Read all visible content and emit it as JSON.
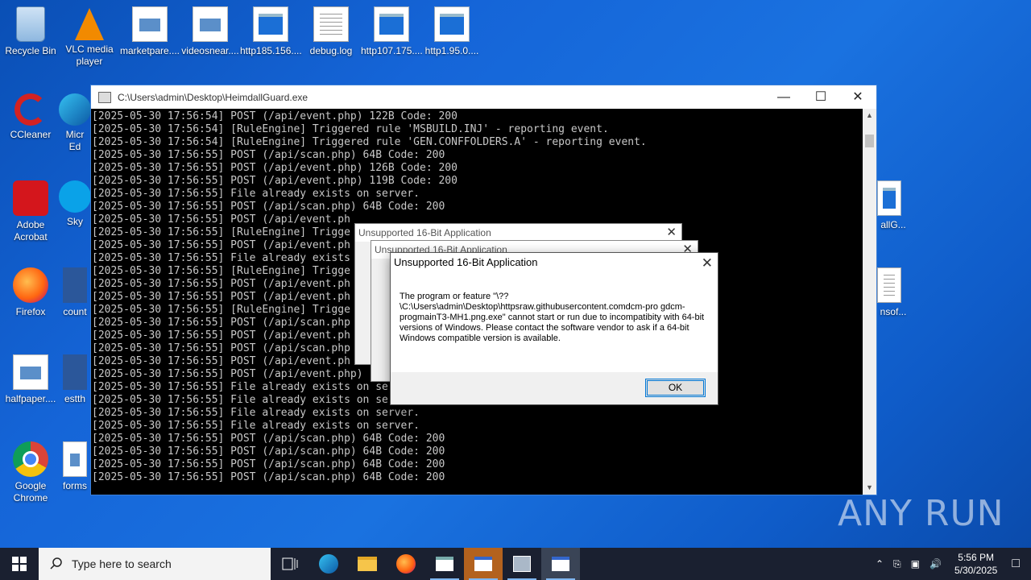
{
  "desktop": {
    "icons": [
      {
        "label": "Recycle Bin"
      },
      {
        "label": "VLC media player"
      },
      {
        "label": "marketpare...."
      },
      {
        "label": "videosnear...."
      },
      {
        "label": "http185.156...."
      },
      {
        "label": "debug.log"
      },
      {
        "label": "http107.175...."
      },
      {
        "label": "http1.95.0...."
      },
      {
        "label": "CCleaner"
      },
      {
        "label": "Micr Ed"
      },
      {
        "label": "Adobe Acrobat"
      },
      {
        "label": "Sky"
      },
      {
        "label": "Firefox"
      },
      {
        "label": "count"
      },
      {
        "label": "halfpaper...."
      },
      {
        "label": "estth"
      },
      {
        "label": "Google Chrome"
      },
      {
        "label": "forms"
      },
      {
        "label": "allG..."
      },
      {
        "label": "nsof..."
      }
    ]
  },
  "console": {
    "title": "C:\\Users\\admin\\Desktop\\HeimdallGuard.exe",
    "lines": [
      "[2025-05-30 17:56:54] POST (/api/event.php) 122B Code: 200",
      "[2025-05-30 17:56:54] [RuleEngine] Triggered rule 'MSBUILD.INJ' - reporting event.",
      "[2025-05-30 17:56:54] [RuleEngine] Triggered rule 'GEN.CONFFOLDERS.A' - reporting event.",
      "[2025-05-30 17:56:55] POST (/api/scan.php) 64B Code: 200",
      "[2025-05-30 17:56:55] POST (/api/event.php) 126B Code: 200",
      "[2025-05-30 17:56:55] POST (/api/event.php) 119B Code: 200",
      "[2025-05-30 17:56:55] File already exists on server.",
      "[2025-05-30 17:56:55] POST (/api/scan.php) 64B Code: 200",
      "[2025-05-30 17:56:55] POST (/api/event.ph",
      "[2025-05-30 17:56:55] [RuleEngine] Trigge",
      "[2025-05-30 17:56:55] POST (/api/event.ph",
      "[2025-05-30 17:56:55] File already exists",
      "[2025-05-30 17:56:55] [RuleEngine] Trigge",
      "[2025-05-30 17:56:55] POST (/api/event.ph",
      "[2025-05-30 17:56:55] POST (/api/event.ph",
      "[2025-05-30 17:56:55] [RuleEngine] Trigge",
      "[2025-05-30 17:56:55] POST (/api/scan.php",
      "[2025-05-30 17:56:55] POST (/api/event.ph",
      "[2025-05-30 17:56:55] POST (/api/scan.php",
      "[2025-05-30 17:56:55] POST (/api/event.ph",
      "[2025-05-30 17:56:55] POST (/api/event.php)",
      "[2025-05-30 17:56:55] File already exists on se",
      "[2025-05-30 17:56:55] File already exists on se",
      "[2025-05-30 17:56:55] File already exists on server.",
      "[2025-05-30 17:56:55] File already exists on server.",
      "[2025-05-30 17:56:55] POST (/api/scan.php) 64B Code: 200",
      "[2025-05-30 17:56:55] POST (/api/scan.php) 64B Code: 200",
      "[2025-05-30 17:56:55] POST (/api/scan.php) 64B Code: 200",
      "[2025-05-30 17:56:55] POST (/api/scan.php) 64B Code: 200"
    ]
  },
  "dialogs": {
    "back1_title": "Unsupported 16-Bit Application",
    "back2_title": "Unsupported 16-Bit Application",
    "main": {
      "title": "Unsupported 16-Bit Application",
      "message": "The program or feature \"\\??\\C:\\Users\\admin\\Desktop\\httpsraw.githubusercontent.comdcm-pro gdcm-progmainT3-MH1.png.exe\" cannot start or run due to incompatibity with 64-bit versions of Windows. Please contact the software vendor to ask if a 64-bit Windows compatible version is available.",
      "ok_label": "OK"
    }
  },
  "taskbar": {
    "search_placeholder": "Type here to search",
    "time": "5:56 PM",
    "date": "5/30/2025"
  },
  "watermark": "ANY RUN"
}
